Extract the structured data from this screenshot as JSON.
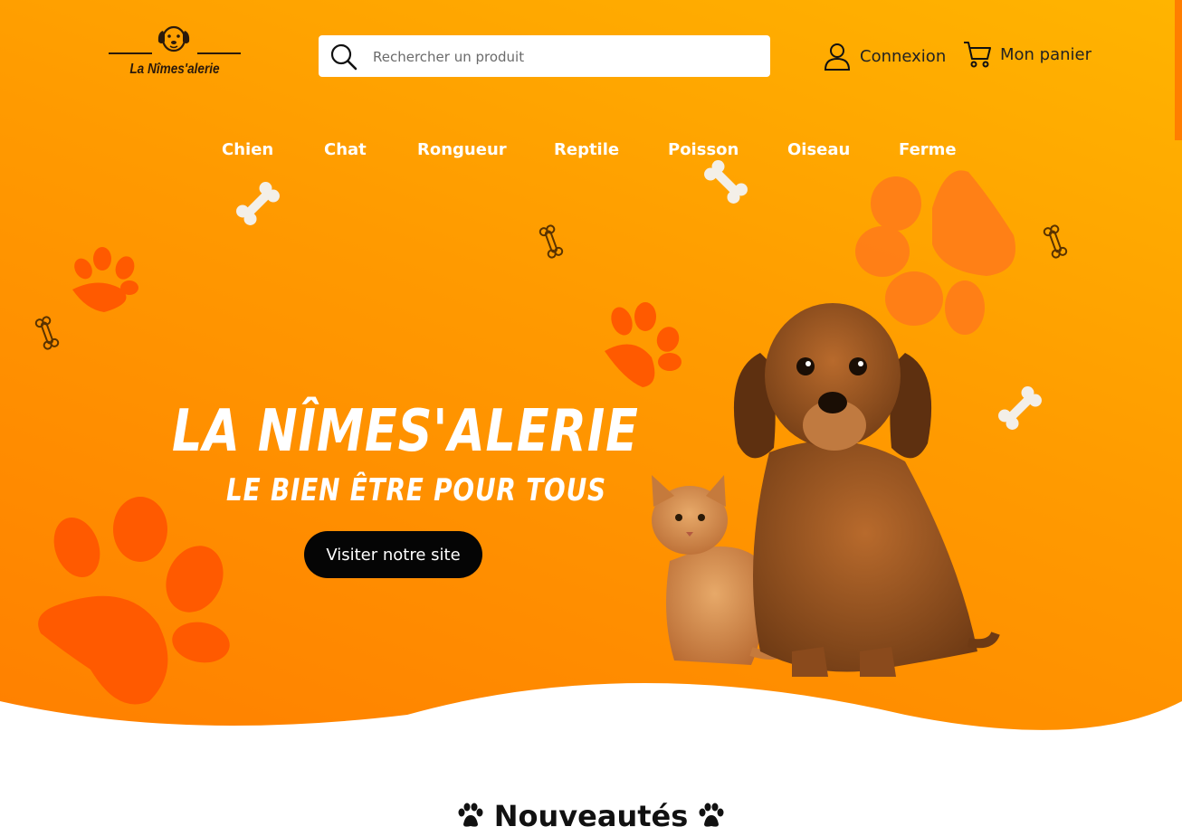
{
  "brand": {
    "name": "La Nîmes'alerie"
  },
  "search": {
    "placeholder": "Rechercher un produit"
  },
  "account": {
    "label": "Connexion"
  },
  "cart": {
    "label": "Mon panier"
  },
  "nav": {
    "items": [
      {
        "label": "Chien"
      },
      {
        "label": "Chat"
      },
      {
        "label": "Rongueur"
      },
      {
        "label": "Reptile"
      },
      {
        "label": "Poisson"
      },
      {
        "label": "Oiseau"
      },
      {
        "label": "Ferme"
      }
    ]
  },
  "hero": {
    "title": "LA NÎMES'ALERIE",
    "subtitle": "LE BIEN ÊTRE POUR TOUS",
    "cta_label": "Visiter notre site"
  },
  "section": {
    "title": "Nouveautés"
  },
  "colors": {
    "hero_top": "#ffb400",
    "hero_bottom": "#ff7f00",
    "paw": "#ff5a00",
    "paw_light": "#ff7a1a",
    "button": "#050505"
  },
  "icons": [
    "dog-logo-icon",
    "search-icon",
    "user-icon",
    "cart-icon",
    "paw-icon",
    "bone-icon"
  ]
}
